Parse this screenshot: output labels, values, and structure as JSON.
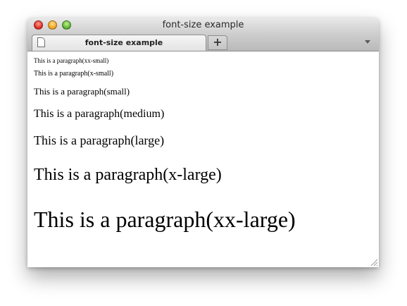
{
  "window": {
    "title": "font-size example"
  },
  "tabs": [
    {
      "label": "font-size example",
      "icon": "page-icon",
      "active": true
    }
  ],
  "toolbar": {
    "new_tab_label": "+",
    "tab_menu_icon": "chevron-down-icon"
  },
  "content": {
    "paragraphs": [
      {
        "size": "xx-small",
        "text": "This is a paragraph(xx-small)"
      },
      {
        "size": "x-small",
        "text": "This is a paragraph(x-small)"
      },
      {
        "size": "small",
        "text": "This is a paragraph(small)"
      },
      {
        "size": "medium",
        "text": "This is a paragraph(medium)"
      },
      {
        "size": "large",
        "text": "This is a paragraph(large)"
      },
      {
        "size": "x-large",
        "text": "This is a paragraph(x-large)"
      },
      {
        "size": "xx-large",
        "text": "This is a paragraph(xx-large)"
      }
    ]
  },
  "colors": {
    "close": "#e2332a",
    "minimize": "#f0a829",
    "zoom": "#62b73a"
  }
}
